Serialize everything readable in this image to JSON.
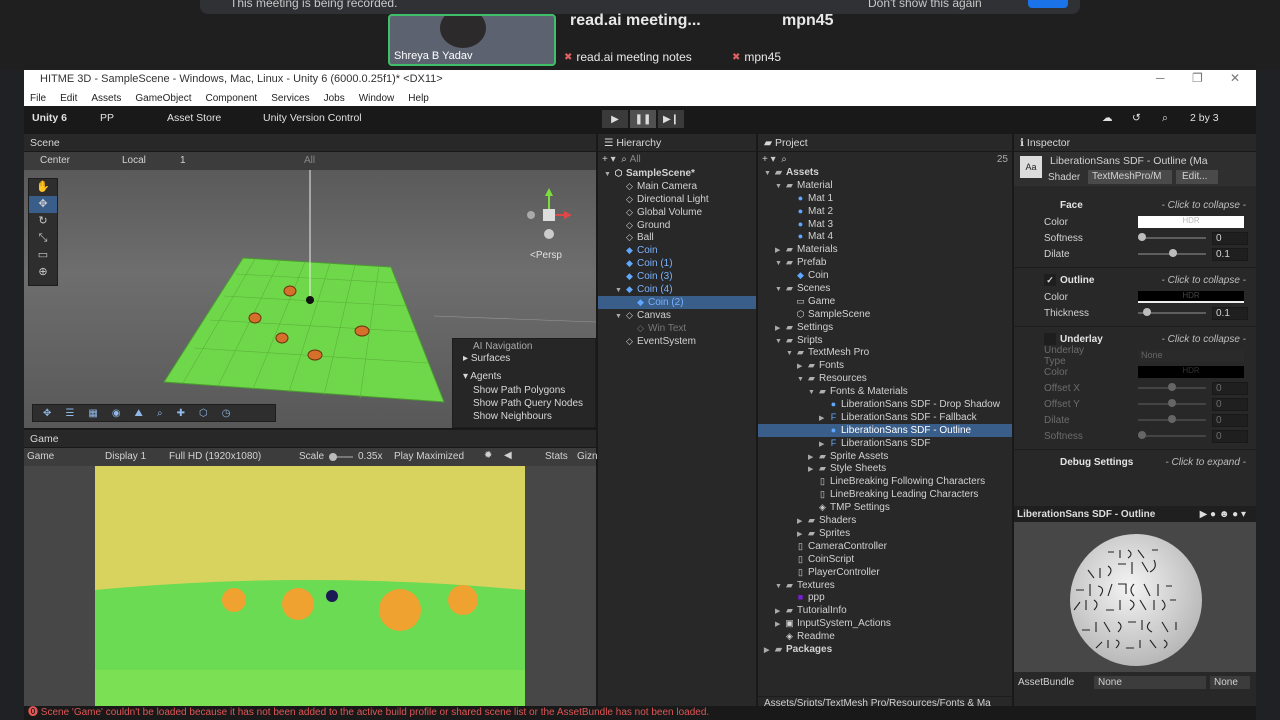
{
  "meeting": {
    "banner_text": "This meeting is being recorded.",
    "dont_show": "Don't show this again",
    "ok_label": "OK",
    "participant_name": "Shreya B Yadav",
    "tile1_title": "read.ai meeting...",
    "tile1_sub": "read.ai meeting notes",
    "tile2_title": "mpn45",
    "tile2_sub": "mpn45"
  },
  "window": {
    "title": "HITME 3D - SampleScene - Windows, Mac, Linux - Unity 6 (6000.0.25f1)* <DX11>"
  },
  "menu": [
    "File",
    "Edit",
    "Assets",
    "GameObject",
    "Component",
    "Services",
    "Jobs",
    "Window",
    "Help"
  ],
  "toolbar": {
    "unity": "Unity 6",
    "account": "PP",
    "asset_store": "Asset Store",
    "version_control": "Unity Version Control",
    "layout": "2 by 3"
  },
  "scene": {
    "tab": "Scene",
    "pivot": "Center",
    "space": "Local",
    "snap": "1",
    "search_placeholder": "All",
    "persp": "<Persp",
    "ai_nav": {
      "title": "AI Navigation",
      "surfaces": "Surfaces",
      "agents": "Agents",
      "items": [
        "Show Path Polygons",
        "Show Path Query Nodes",
        "Show Neighbours"
      ]
    }
  },
  "game": {
    "tab": "Game",
    "mode": "Game",
    "display": "Display 1",
    "resolution": "Full HD (1920x1080)",
    "scale_label": "Scale",
    "scale_value": "0.35x",
    "play_mode": "Play Maximized",
    "stats": "Stats",
    "gizmos": "Gizn"
  },
  "hierarchy": {
    "tab": "Hierarchy",
    "search_placeholder": "All",
    "rows": [
      {
        "label": "SampleScene*",
        "indent": 0,
        "arrow": "▼",
        "icon": "⬡",
        "cls": "bold"
      },
      {
        "label": "Main Camera",
        "indent": 1,
        "arrow": "",
        "icon": "◇",
        "cls": ""
      },
      {
        "label": "Directional Light",
        "indent": 1,
        "arrow": "",
        "icon": "◇",
        "cls": ""
      },
      {
        "label": "Global Volume",
        "indent": 1,
        "arrow": "",
        "icon": "◇",
        "cls": ""
      },
      {
        "label": "Ground",
        "indent": 1,
        "arrow": "",
        "icon": "◇",
        "cls": ""
      },
      {
        "label": "Ball",
        "indent": 1,
        "arrow": "",
        "icon": "◇",
        "cls": ""
      },
      {
        "label": "Coin",
        "indent": 1,
        "arrow": "",
        "icon": "◆",
        "cls": "blue"
      },
      {
        "label": "Coin (1)",
        "indent": 1,
        "arrow": "",
        "icon": "◆",
        "cls": "blue"
      },
      {
        "label": "Coin (3)",
        "indent": 1,
        "arrow": "",
        "icon": "◆",
        "cls": "blue"
      },
      {
        "label": "Coin (4)",
        "indent": 1,
        "arrow": "▼",
        "icon": "◆",
        "cls": "blue"
      },
      {
        "label": "Coin (2)",
        "indent": 2,
        "arrow": "",
        "icon": "◆",
        "cls": "blue sel"
      },
      {
        "label": "Canvas",
        "indent": 1,
        "arrow": "▼",
        "icon": "◇",
        "cls": ""
      },
      {
        "label": "Win Text",
        "indent": 2,
        "arrow": "",
        "icon": "◇",
        "cls": "dim"
      },
      {
        "label": "EventSystem",
        "indent": 1,
        "arrow": "",
        "icon": "◇",
        "cls": ""
      }
    ]
  },
  "project": {
    "tab": "Project",
    "badge": "25",
    "path": "Assets/Sripts/TextMesh Pro/Resources/Fonts & Ma",
    "rows": [
      {
        "label": "Assets",
        "indent": 0,
        "arrow": "▼",
        "icon": "▰",
        "cls": "bold"
      },
      {
        "label": "Material",
        "indent": 1,
        "arrow": "▼",
        "icon": "▰",
        "cls": ""
      },
      {
        "label": "Mat 1",
        "indent": 2,
        "arrow": "",
        "icon": "●",
        "cls": ""
      },
      {
        "label": "Mat 2",
        "indent": 2,
        "arrow": "",
        "icon": "●",
        "cls": ""
      },
      {
        "label": "Mat 3",
        "indent": 2,
        "arrow": "",
        "icon": "●",
        "cls": ""
      },
      {
        "label": "Mat 4",
        "indent": 2,
        "arrow": "",
        "icon": "●",
        "cls": ""
      },
      {
        "label": "Materials",
        "indent": 1,
        "arrow": "▶",
        "icon": "▰",
        "cls": ""
      },
      {
        "label": "Prefab",
        "indent": 1,
        "arrow": "▼",
        "icon": "▰",
        "cls": ""
      },
      {
        "label": "Coin",
        "indent": 2,
        "arrow": "",
        "icon": "◆",
        "cls": ""
      },
      {
        "label": "Scenes",
        "indent": 1,
        "arrow": "▼",
        "icon": "▰",
        "cls": ""
      },
      {
        "label": "Game",
        "indent": 2,
        "arrow": "",
        "icon": "▭",
        "cls": ""
      },
      {
        "label": "SampleScene",
        "indent": 2,
        "arrow": "",
        "icon": "⬡",
        "cls": ""
      },
      {
        "label": "Settings",
        "indent": 1,
        "arrow": "▶",
        "icon": "▰",
        "cls": ""
      },
      {
        "label": "Sripts",
        "indent": 1,
        "arrow": "▼",
        "icon": "▰",
        "cls": ""
      },
      {
        "label": "TextMesh Pro",
        "indent": 2,
        "arrow": "▼",
        "icon": "▰",
        "cls": ""
      },
      {
        "label": "Fonts",
        "indent": 3,
        "arrow": "▶",
        "icon": "▰",
        "cls": ""
      },
      {
        "label": "Resources",
        "indent": 3,
        "arrow": "▼",
        "icon": "▰",
        "cls": ""
      },
      {
        "label": "Fonts & Materials",
        "indent": 4,
        "arrow": "▼",
        "icon": "▰",
        "cls": ""
      },
      {
        "label": "LiberationSans SDF - Drop Shadow",
        "indent": 5,
        "arrow": "",
        "icon": "●",
        "cls": ""
      },
      {
        "label": "LiberationSans SDF - Fallback",
        "indent": 5,
        "arrow": "▶",
        "icon": "F",
        "cls": ""
      },
      {
        "label": "LiberationSans SDF - Outline",
        "indent": 5,
        "arrow": "",
        "icon": "●",
        "cls": "sel"
      },
      {
        "label": "LiberationSans SDF",
        "indent": 5,
        "arrow": "▶",
        "icon": "F",
        "cls": ""
      },
      {
        "label": "Sprite Assets",
        "indent": 4,
        "arrow": "▶",
        "icon": "▰",
        "cls": ""
      },
      {
        "label": "Style Sheets",
        "indent": 4,
        "arrow": "▶",
        "icon": "▰",
        "cls": ""
      },
      {
        "label": "LineBreaking Following Characters",
        "indent": 4,
        "arrow": "",
        "icon": "▯",
        "cls": ""
      },
      {
        "label": "LineBreaking Leading Characters",
        "indent": 4,
        "arrow": "",
        "icon": "▯",
        "cls": ""
      },
      {
        "label": "TMP Settings",
        "indent": 4,
        "arrow": "",
        "icon": "◈",
        "cls": ""
      },
      {
        "label": "Shaders",
        "indent": 3,
        "arrow": "▶",
        "icon": "▰",
        "cls": ""
      },
      {
        "label": "Sprites",
        "indent": 3,
        "arrow": "▶",
        "icon": "▰",
        "cls": ""
      },
      {
        "label": "CameraController",
        "indent": 2,
        "arrow": "",
        "icon": "▯",
        "cls": ""
      },
      {
        "label": "CoinScript",
        "indent": 2,
        "arrow": "",
        "icon": "▯",
        "cls": ""
      },
      {
        "label": "PlayerController",
        "indent": 2,
        "arrow": "",
        "icon": "▯",
        "cls": ""
      },
      {
        "label": "Textures",
        "indent": 1,
        "arrow": "▼",
        "icon": "▰",
        "cls": ""
      },
      {
        "label": "ppp",
        "indent": 2,
        "arrow": "",
        "icon": "■",
        "cls": ""
      },
      {
        "label": "TutorialInfo",
        "indent": 1,
        "arrow": "▶",
        "icon": "▰",
        "cls": ""
      },
      {
        "label": "InputSystem_Actions",
        "indent": 1,
        "arrow": "▶",
        "icon": "▣",
        "cls": ""
      },
      {
        "label": "Readme",
        "indent": 1,
        "arrow": "",
        "icon": "◈",
        "cls": ""
      },
      {
        "label": "Packages",
        "indent": 0,
        "arrow": "▶",
        "icon": "▰",
        "cls": "bold"
      }
    ]
  },
  "inspector": {
    "tab": "Inspector",
    "asset_title": "LiberationSans SDF - Outline (Ma",
    "shader_label": "Shader",
    "shader_value": "TextMeshPro/M",
    "edit_label": "Edit...",
    "collapse_text": "- Click to collapse -",
    "expand_text": "- Click to expand -",
    "face": {
      "title": "Face",
      "color": "Color",
      "hdr": "HDR",
      "softness": "Softness",
      "softness_val": "0",
      "dilate": "Dilate",
      "dilate_val": "0.1"
    },
    "outline": {
      "title": "Outline",
      "color": "Color",
      "hdr": "HDR",
      "thickness": "Thickness",
      "thickness_val": "0.1"
    },
    "underlay": {
      "title": "Underlay",
      "type": "Underlay Type",
      "type_val": "None",
      "color": "Color",
      "hdr": "HDR",
      "offset_x": "Offset X",
      "offset_x_val": "0",
      "offset_y": "Offset Y",
      "offset_y_val": "0",
      "dilate": "Dilate",
      "dilate_val": "0",
      "softness": "Softness",
      "softness_val": "0"
    },
    "debug": "Debug Settings",
    "preview_title": "LiberationSans SDF - Outline",
    "asset_bundle_label": "AssetBundle",
    "asset_bundle_value": "None",
    "asset_bundle_variant": "None"
  },
  "status": {
    "message": "Scene 'Game' couldn't be loaded because it has not been added to the active build profile or shared scene list or the AssetBundle has not been loaded."
  },
  "colors": {
    "accent": "#3a5e8a",
    "coin": "#f0a230",
    "ground": "#7ddc3a",
    "game_bg": "#d8d35e"
  }
}
